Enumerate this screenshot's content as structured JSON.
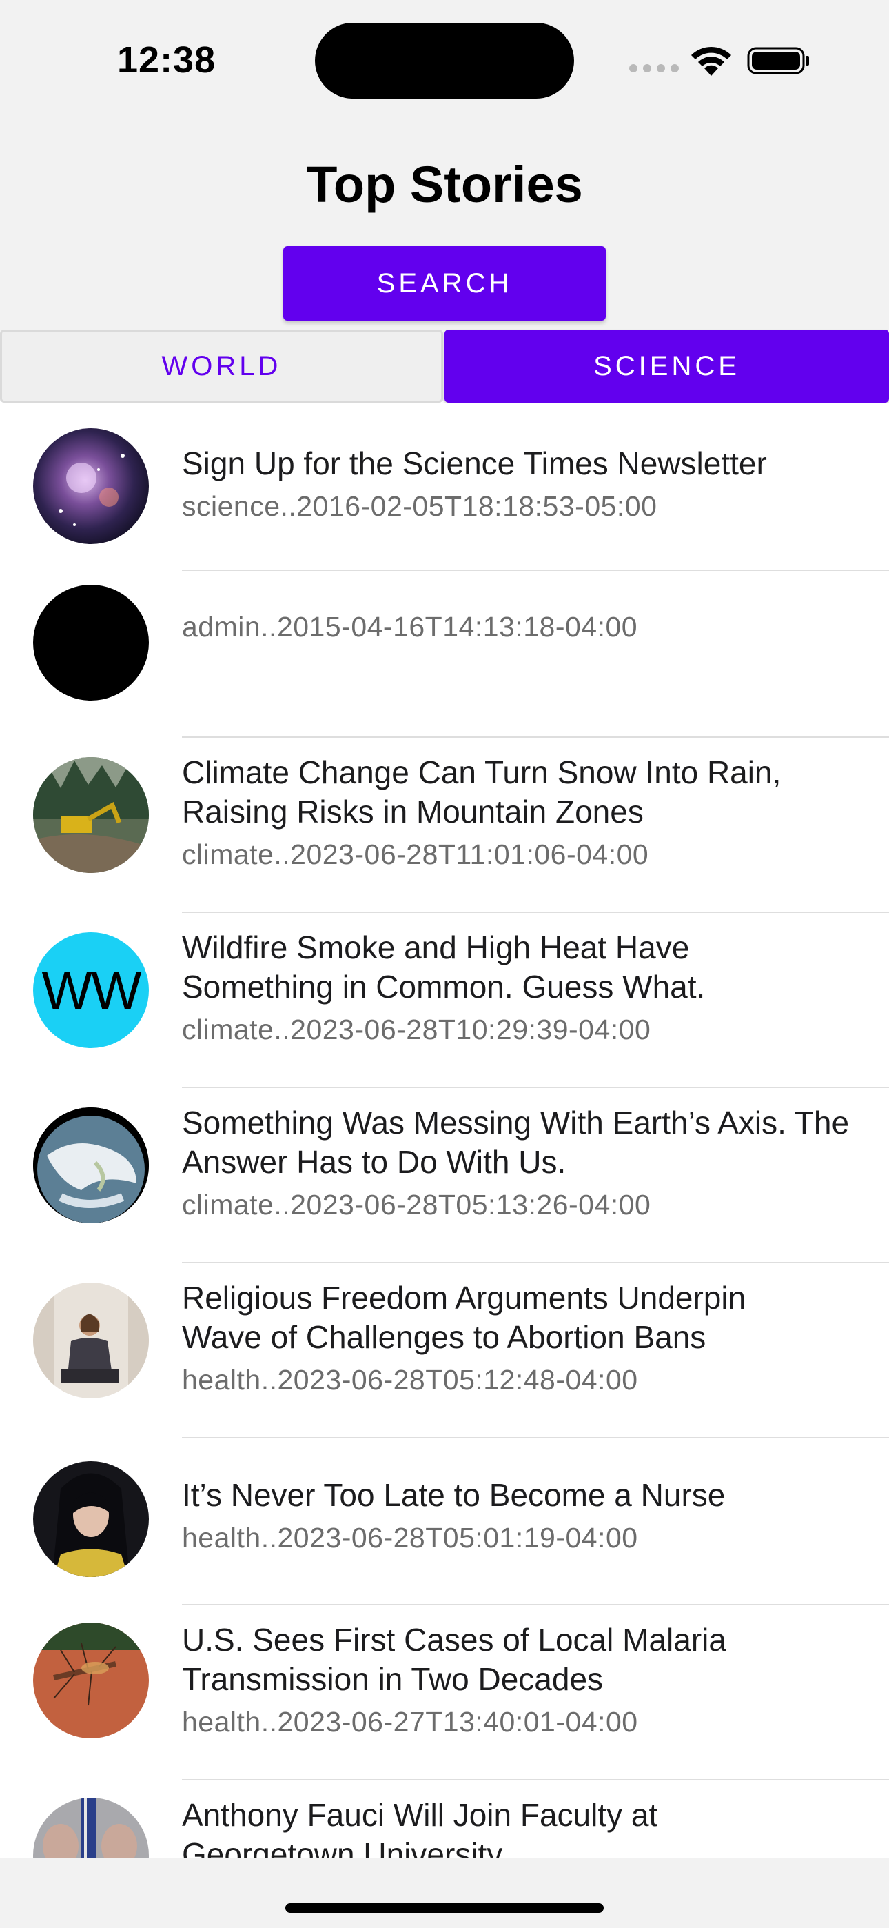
{
  "status_bar": {
    "time": "12:38"
  },
  "header": {
    "title": "Top Stories",
    "search_label": "SEARCH"
  },
  "tabs": [
    {
      "label": "WORLD",
      "selected": false
    },
    {
      "label": "SCIENCE",
      "selected": true
    }
  ],
  "colors": {
    "accent": "#6200ee",
    "background_header": "#f2f2f2",
    "meta_text": "#6c6c6c"
  },
  "articles": [
    {
      "headline": "Sign Up for the Science Times Newsletter",
      "meta": "science..2016-02-05T18:18:53-05:00",
      "thumbnail": "galaxy-image"
    },
    {
      "headline": "",
      "meta": "admin..2015-04-16T14:13:18-04:00",
      "thumbnail": "black-placeholder"
    },
    {
      "headline": "Climate Change Can Turn Snow Into Rain, Raising Risks in Mountain Zones",
      "meta": "climate..2023-06-28T11:01:06-04:00",
      "thumbnail": "excavator-image"
    },
    {
      "headline": "Wildfire Smoke and High Heat Have Something in Common. Guess What.",
      "meta": "climate..2023-06-28T10:29:39-04:00",
      "thumbnail": "ww-logo",
      "thumbnail_text": "WW"
    },
    {
      "headline": "Something Was Messing With Earth’s Axis. The Answer Has to Do With Us.",
      "meta": "climate..2023-06-28T05:13:26-04:00",
      "thumbnail": "earth-image"
    },
    {
      "headline": "Religious Freedom Arguments Underpin Wave of Challenges to Abortion Bans",
      "meta": "health..2023-06-28T05:12:48-04:00",
      "thumbnail": "seated-woman-image"
    },
    {
      "headline": "It’s Never Too Late to Become a Nurse",
      "meta": "health..2023-06-28T05:01:19-04:00",
      "thumbnail": "portrait-image"
    },
    {
      "headline": "U.S. Sees First Cases of Local Malaria Transmission in Two Decades",
      "meta": "health..2023-06-27T13:40:01-04:00",
      "thumbnail": "mosquito-image"
    },
    {
      "headline": "Anthony Fauci Will Join Faculty at Georgetown University",
      "meta": "",
      "thumbnail": "fauci-image"
    }
  ]
}
